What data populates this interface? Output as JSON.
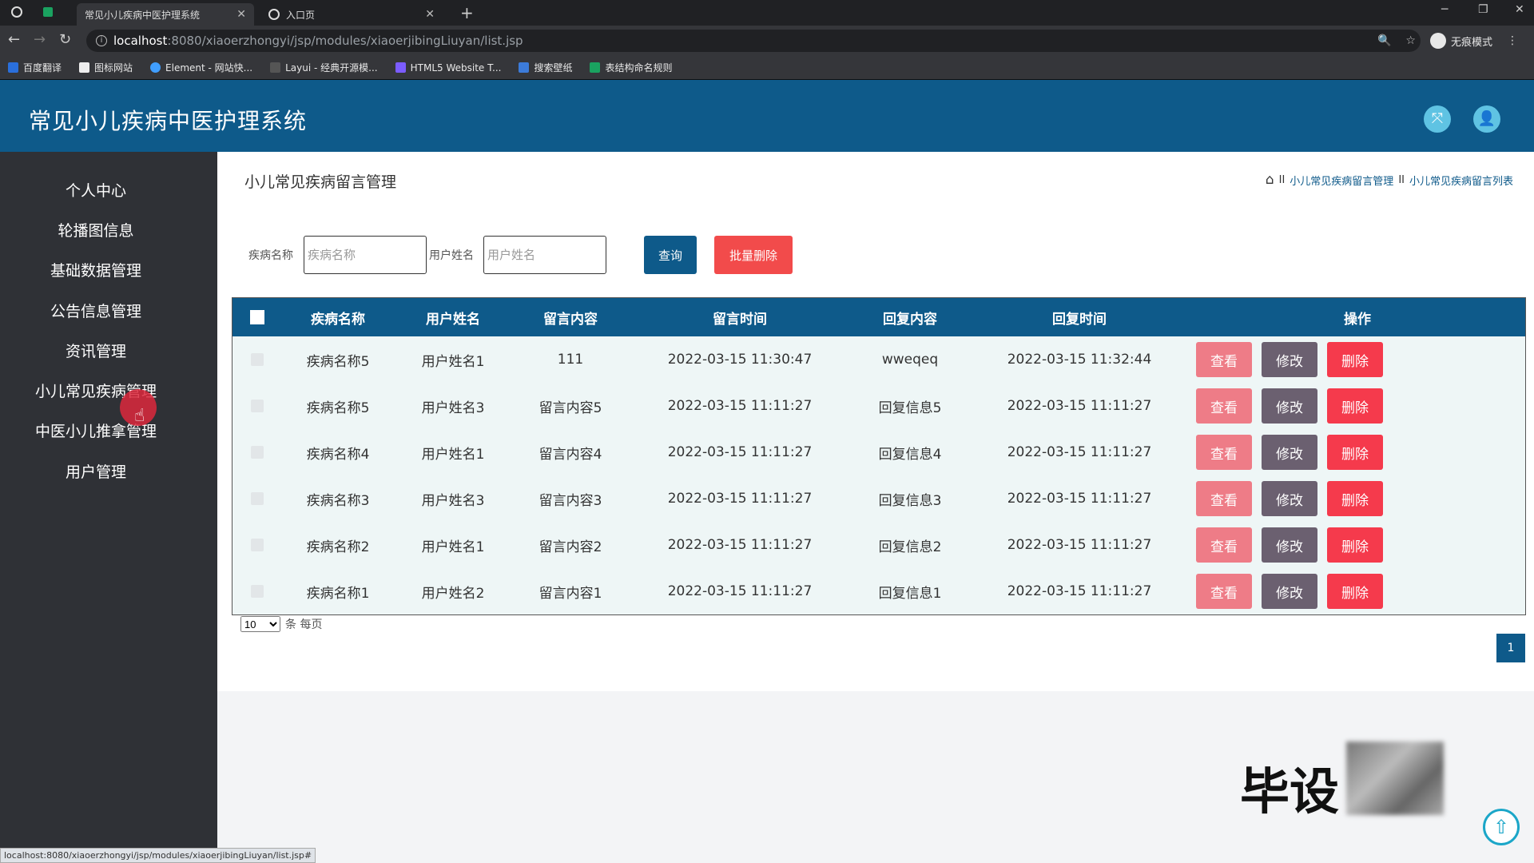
{
  "browser": {
    "tabs": [
      {
        "title": "常见小儿疾病中医护理系统",
        "active": true
      },
      {
        "title": "入口页",
        "active": false
      }
    ],
    "new_tab": "+",
    "url_host": "localhost",
    "url_path": ":8080/xiaoerzhongyi/jsp/modules/xiaoerjibingLiuyan/list.jsp",
    "incognito_label": "无痕模式",
    "bookmarks": [
      "百度翻译",
      "图标网站",
      "Element - 网站快...",
      "Layui - 经典开源模...",
      "HTML5 Website T...",
      "搜索壁纸",
      "表结构命名规则"
    ]
  },
  "header": {
    "title": "常见小儿疾病中医护理系统",
    "colors": {
      "primary": "#0e5a8a",
      "icon_bg": "#5fc3e3"
    }
  },
  "sidebar": {
    "items": [
      {
        "label": "个人中心"
      },
      {
        "label": "轮播图信息"
      },
      {
        "label": "基础数据管理"
      },
      {
        "label": "公告信息管理"
      },
      {
        "label": "资讯管理"
      },
      {
        "label": "小儿常见疾病管理"
      },
      {
        "label": "中医小儿推拿管理"
      },
      {
        "label": "用户管理"
      }
    ]
  },
  "page": {
    "heading": "小儿常见疾病留言管理",
    "breadcrumb": [
      "小儿常见疾病留言管理",
      "小儿常见疾病留言列表"
    ],
    "breadcrumb_sep": "II"
  },
  "filters": {
    "disease_label": "疾病名称",
    "disease_placeholder": "疾病名称",
    "user_label": "用户姓名",
    "user_placeholder": "用户姓名",
    "search_button": "查询",
    "batch_delete_button": "批量删除"
  },
  "table": {
    "columns": [
      "疾病名称",
      "用户姓名",
      "留言内容",
      "留言时间",
      "回复内容",
      "回复时间",
      "操作"
    ],
    "rows": [
      [
        "疾病名称5",
        "用户姓名1",
        "111",
        "2022-03-15 11:30:47",
        "wweqeq",
        "2022-03-15 11:32:44"
      ],
      [
        "疾病名称5",
        "用户姓名3",
        "留言内容5",
        "2022-03-15 11:11:27",
        "回复信息5",
        "2022-03-15 11:11:27"
      ],
      [
        "疾病名称4",
        "用户姓名1",
        "留言内容4",
        "2022-03-15 11:11:27",
        "回复信息4",
        "2022-03-15 11:11:27"
      ],
      [
        "疾病名称3",
        "用户姓名3",
        "留言内容3",
        "2022-03-15 11:11:27",
        "回复信息3",
        "2022-03-15 11:11:27"
      ],
      [
        "疾病名称2",
        "用户姓名1",
        "留言内容2",
        "2022-03-15 11:11:27",
        "回复信息2",
        "2022-03-15 11:11:27"
      ],
      [
        "疾病名称1",
        "用户姓名2",
        "留言内容1",
        "2022-03-15 11:11:27",
        "回复信息1",
        "2022-03-15 11:11:27"
      ]
    ],
    "actions": {
      "view": "查看",
      "edit": "修改",
      "delete": "删除"
    }
  },
  "pagination": {
    "page_size": "10",
    "page_size_suffix": "条 每页",
    "current_page": "1"
  },
  "watermark": "毕设",
  "status_url": "localhost:8080/xiaoerzhongyi/jsp/modules/xiaoerjibingLiuyan/list.jsp#"
}
